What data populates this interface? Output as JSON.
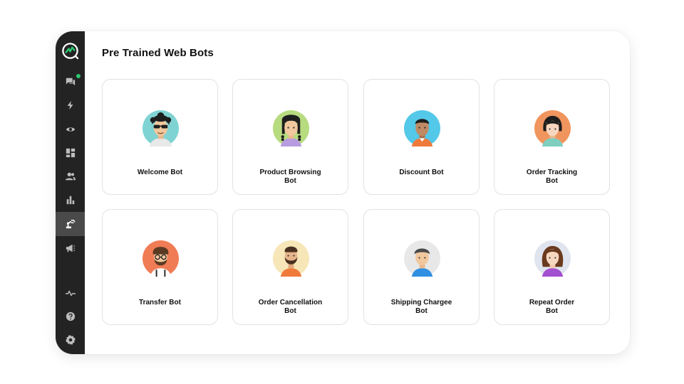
{
  "page": {
    "title": "Pre Trained Web Bots"
  },
  "sidebar": {
    "logo": "brand-logo",
    "items": [
      {
        "icon": "chat-icon",
        "badge": true
      },
      {
        "icon": "lightning-icon"
      },
      {
        "icon": "eye-icon"
      },
      {
        "icon": "dashboard-icon"
      },
      {
        "icon": "users-icon"
      },
      {
        "icon": "bar-chart-icon"
      },
      {
        "icon": "robot-arm-icon",
        "active": true
      },
      {
        "icon": "megaphone-icon"
      },
      {
        "icon": "activity-icon"
      },
      {
        "icon": "help-icon"
      },
      {
        "icon": "settings-icon"
      }
    ]
  },
  "colors": {
    "accent_green": "#2ec46f",
    "sidebar_bg": "#232323",
    "active_item": "#4a4a4a"
  },
  "bots": [
    {
      "label": "Welcome Bot",
      "avatar": "curly-hair-sunglasses-avatar",
      "bg": "#7fd3d3"
    },
    {
      "label": "Product Browsing\nBot",
      "avatar": "braids-avatar",
      "bg": "#b7db7f"
    },
    {
      "label": "Discount Bot",
      "avatar": "man-orange-shirt-avatar",
      "bg": "#54c8e8"
    },
    {
      "label": "Order Tracking\nBot",
      "avatar": "woman-bob-avatar",
      "bg": "#f0955e"
    },
    {
      "label": "Transfer Bot",
      "avatar": "bearded-glasses-avatar",
      "bg": "#f07c55"
    },
    {
      "label": "Order Cancellation\nBot",
      "avatar": "bearded-man-avatar",
      "bg": "#f7e6b8"
    },
    {
      "label": "Shipping Chargee\nBot",
      "avatar": "man-blue-shirt-avatar",
      "bg": "#e8e8e8"
    },
    {
      "label": "Repeat Order\nBot",
      "avatar": "long-hair-woman-avatar",
      "bg": "#dfe4ee"
    }
  ]
}
